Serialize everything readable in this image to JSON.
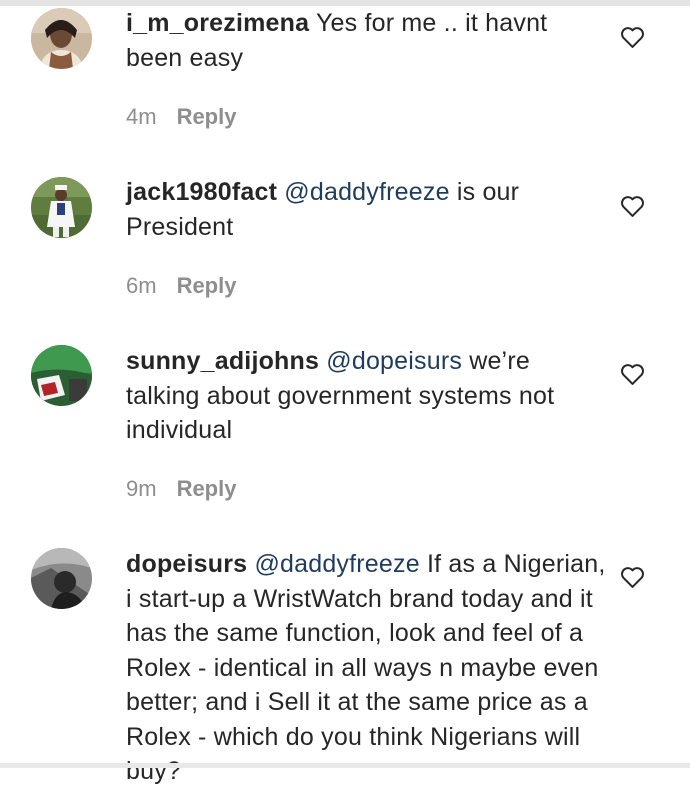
{
  "comments": [
    {
      "username": "i_m_orezimena",
      "mention": "",
      "text": "Yes for me .. it havnt been easy",
      "time": "4m",
      "reply_label": "Reply",
      "avatar_icon": "profile-photo-woman",
      "heart_icon": "heart-outline-icon"
    },
    {
      "username": "jack1980fact",
      "mention": "@daddyfreeze",
      "text": "is our President",
      "time": "6m",
      "reply_label": "Reply",
      "avatar_icon": "profile-photo-man-white-outfit",
      "heart_icon": "heart-outline-icon"
    },
    {
      "username": "sunny_adijohns",
      "mention": "@dopeisurs",
      "text": "we’re talking about government systems not individual",
      "time": "9m",
      "reply_label": "Reply",
      "avatar_icon": "profile-photo-green-flag",
      "heart_icon": "heart-outline-icon"
    },
    {
      "username": "dopeisurs",
      "mention": "@daddyfreeze",
      "text": "If as a Nigerian, i start-up a WristWatch brand today and it has the same function, look and feel of a Rolex - identical in all ways n maybe even better; and i Sell it at the same price as a Rolex - which do you think Nigerians will buy?",
      "time": "",
      "reply_label": "",
      "avatar_icon": "profile-photo-man-bw",
      "heart_icon": "heart-outline-icon"
    }
  ],
  "colors": {
    "text": "#262626",
    "mention": "#1f3c5e",
    "meta": "#8e8e8e"
  }
}
